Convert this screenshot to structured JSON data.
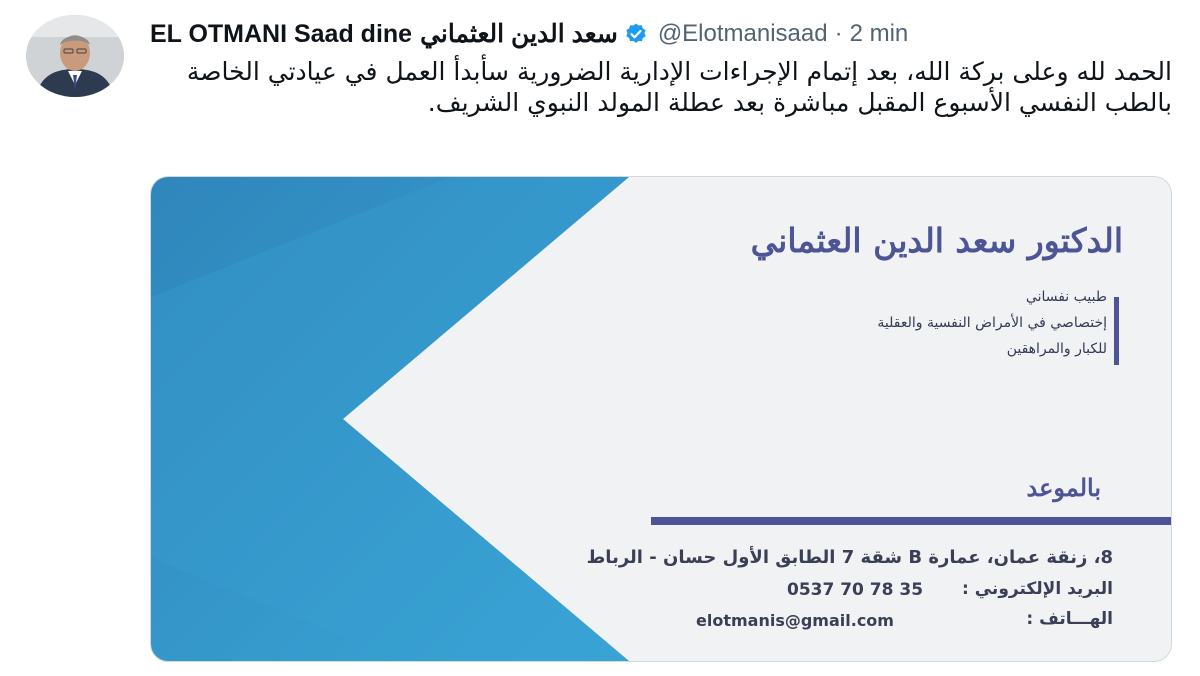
{
  "tweet": {
    "author_name": "EL OTMANI Saad dine",
    "author_name_ar": "سعد الدين العثماني",
    "handle": "@Elotmanisaad",
    "separator": "·",
    "time": "2 min",
    "text": "الحمد لله وعلى بركة الله، بعد إتمام الإجراءات الإدارية الضرورية سأبدأ العمل في عيادتي الخاصة بالطب النفسي الأسبوع المقبل مباشرة بعد عطلة المولد النبوي الشريف."
  },
  "business_card": {
    "doctor_name": "الدكتور سعد الدين العثماني",
    "specialty_lines": [
      "طبيب نفساني",
      "إختصاصي في الأمراض النفسية والعقلية",
      "للكبار والمراهقين"
    ],
    "appointment_label": "بالموعد",
    "address": "8، زنقة عمان، عمارة B شقة 7 الطابق الأول حسان - الرباط",
    "email_label": "البريد الإلكتروني :",
    "phone_label": "الهـــاتف :",
    "phone": "0537 70 78 35",
    "email": "elotmanis@gmail.com"
  },
  "icons": {
    "verified": "verified-badge-icon",
    "avatar": "profile-photo"
  },
  "colors": {
    "verified_blue": "#1d9bf0",
    "card_blue": "#2a8fc4",
    "card_text_purple": "#4d5596",
    "secondary_text": "#536471"
  }
}
